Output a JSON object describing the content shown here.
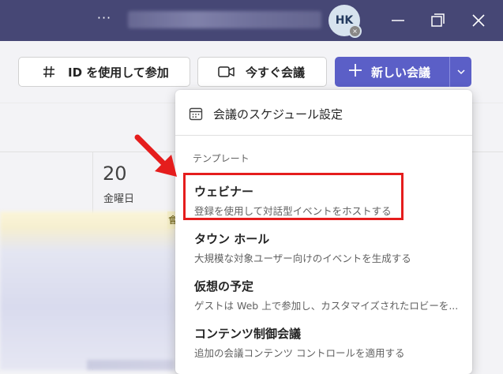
{
  "titlebar": {
    "more_label": "···",
    "avatar_initials": "HK",
    "avatar_status_glyph": "×",
    "colors": {
      "background": "#464775"
    }
  },
  "toolbar": {
    "join_with_id_label": "ID を使用して参加",
    "meet_now_label": "今すぐ会議",
    "new_meeting_label": "新しい会議",
    "colors": {
      "primary": "#5b5fc7"
    }
  },
  "calendar": {
    "day_number": "20",
    "day_name": "金曜日",
    "chip_text": "會"
  },
  "menu": {
    "schedule_label": "会議のスケジュール設定",
    "section_label": "テンプレート",
    "items": [
      {
        "title": "ウェビナー",
        "description": "登録を使用して対話型イベントをホストする"
      },
      {
        "title": "タウン ホール",
        "description": "大規模な対象ユーザー向けのイベントを生成する"
      },
      {
        "title": "仮想の予定",
        "description": "ゲストは Web 上で参加し、カスタマイズされたロビーを..."
      },
      {
        "title": "コンテンツ制御会議",
        "description": "追加の会議コンテンツ コントロールを適用する"
      }
    ]
  },
  "annotation": {
    "highlight_color": "#e51d1d"
  },
  "icons": [
    "more-icon",
    "minimize-icon",
    "maximize-icon",
    "close-icon",
    "hash-icon",
    "video-camera-icon",
    "plus-icon",
    "chevron-down-icon",
    "calendar-icon",
    "arrow-pointer-icon"
  ]
}
